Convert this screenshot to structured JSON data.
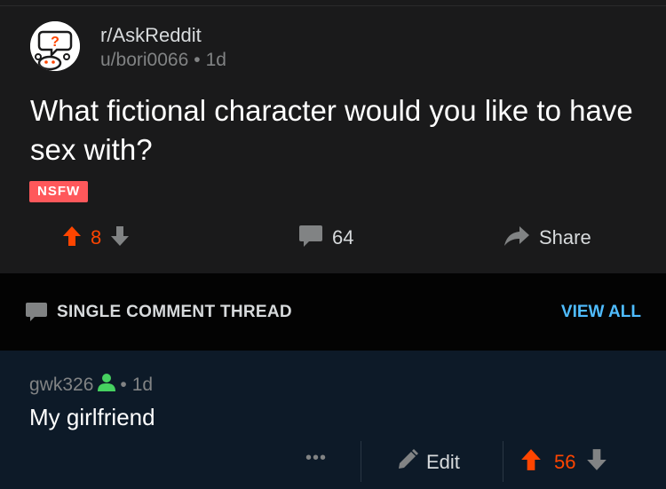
{
  "post": {
    "subreddit": "r/AskReddit",
    "author": "u/bori0066",
    "separator": "•",
    "age": "1d",
    "title": "What fictional character would you like to have sex with?",
    "flair": "NSFW",
    "score": "8",
    "comment_count": "64",
    "share_label": "Share"
  },
  "thread": {
    "label": "SINGLE COMMENT THREAD",
    "view_all": "VIEW ALL"
  },
  "comment": {
    "author": "gwk326",
    "separator": "•",
    "age": "1d",
    "body": "My girlfriend",
    "more": "•••",
    "edit_label": "Edit",
    "score": "56"
  },
  "colors": {
    "upvote": "#ff4500",
    "nsfw": "#ff585b",
    "link": "#4fbcff",
    "op_icon": "#46d160"
  }
}
